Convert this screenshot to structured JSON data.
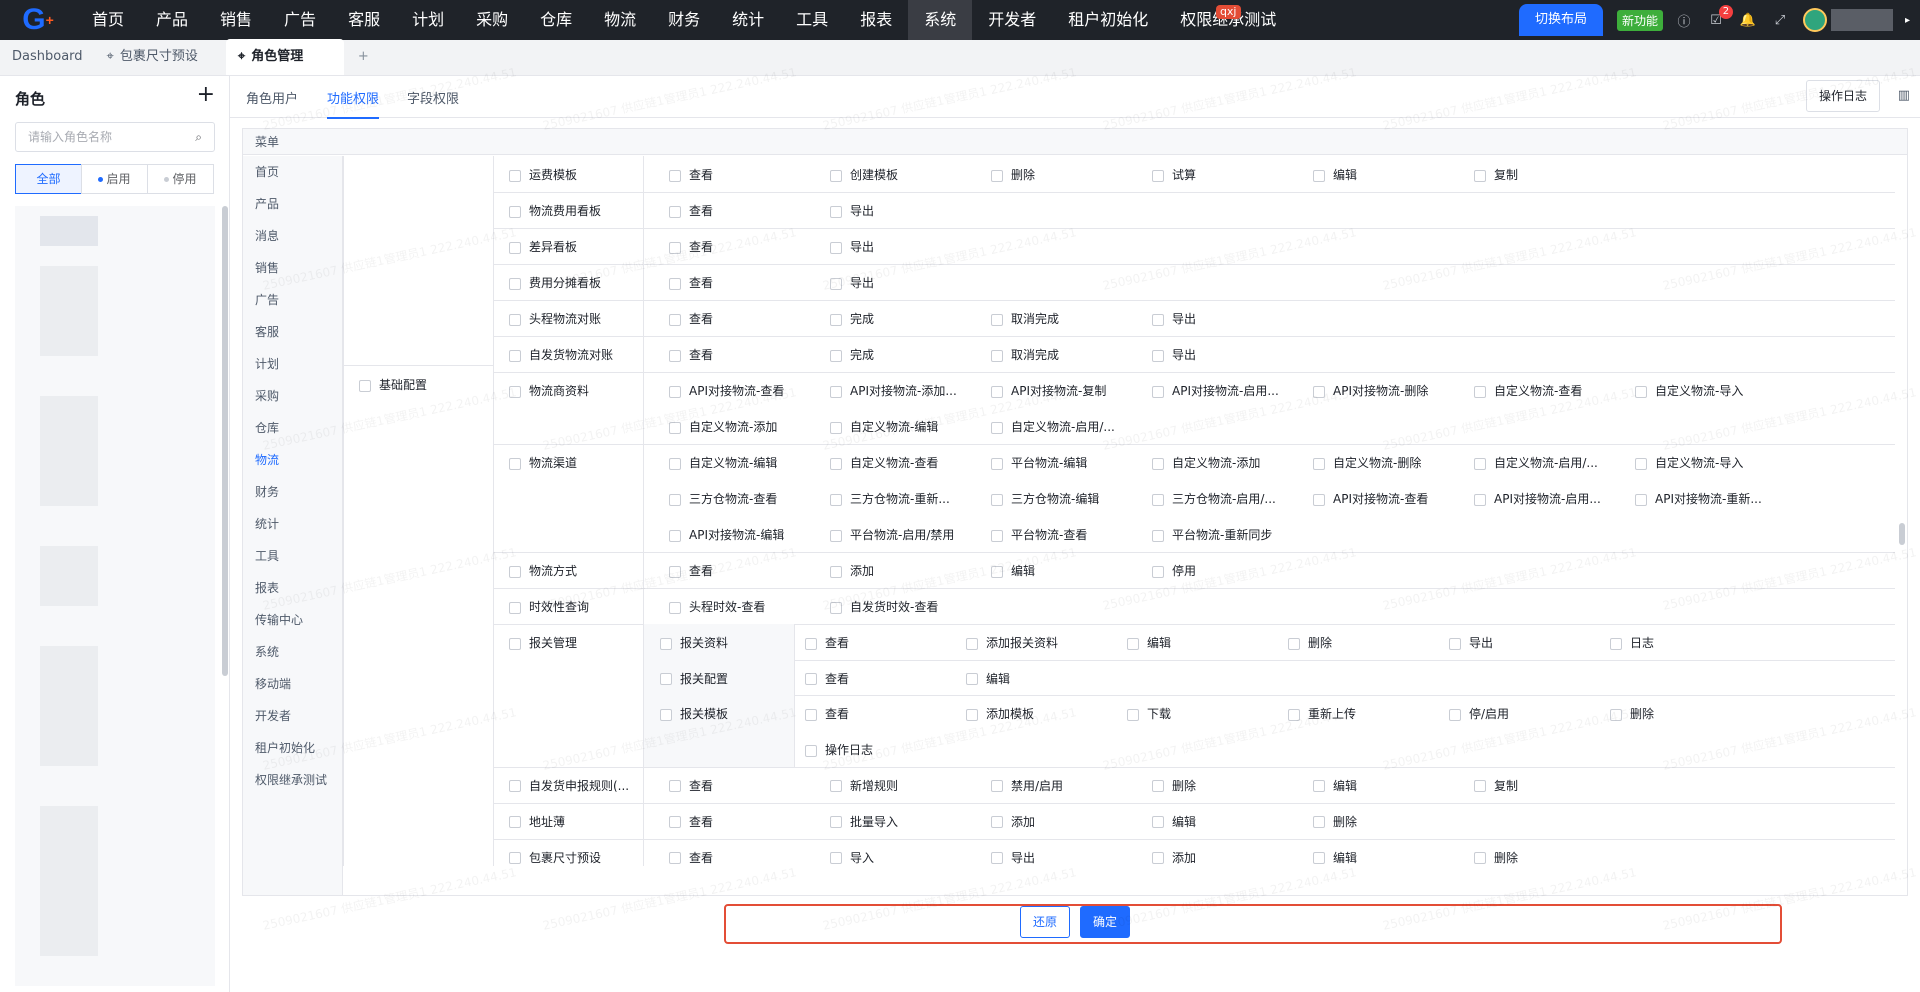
{
  "topnav": {
    "items": [
      "首页",
      "产品",
      "销售",
      "广告",
      "客服",
      "计划",
      "采购",
      "仓库",
      "物流",
      "财务",
      "统计",
      "工具",
      "报表",
      "系统",
      "开发者",
      "租户初始化",
      "权限继承测试"
    ],
    "active_index": 13,
    "switch_layout": "切换布局",
    "qxj_tag": "qxj",
    "new_feature": "新功能",
    "notif_count": "2"
  },
  "tabs": {
    "dashboard": "Dashboard",
    "package_preset": "包裹尺寸预设",
    "role_mgmt": "角色管理",
    "add": "+"
  },
  "sidebar": {
    "title": "角色",
    "add": "+",
    "search_placeholder": "请输入角色名称",
    "filters": [
      "全部",
      "启用",
      "停用"
    ]
  },
  "subtabs": [
    "角色用户",
    "功能权限",
    "字段权限"
  ],
  "oplog": "操作日志",
  "panel": {
    "header": "菜单",
    "menu": [
      "首页",
      "产品",
      "消息",
      "销售",
      "广告",
      "客服",
      "计划",
      "采购",
      "仓库",
      "物流",
      "财务",
      "统计",
      "工具",
      "报表",
      "传输中心",
      "系统",
      "移动端",
      "开发者",
      "租户初始化",
      "权限继承测试"
    ],
    "menu_active": "物流",
    "group_label": "基础配置",
    "rows": [
      {
        "name": "运费模板",
        "perms": [
          "查看",
          "创建模板",
          "删除",
          "试算",
          "编辑",
          "复制"
        ]
      },
      {
        "name": "物流费用看板",
        "perms": [
          "查看",
          "导出"
        ]
      },
      {
        "name": "差异看板",
        "perms": [
          "查看",
          "导出"
        ]
      },
      {
        "name": "费用分摊看板",
        "perms": [
          "查看",
          "导出"
        ]
      },
      {
        "name": "头程物流对账",
        "perms": [
          "查看",
          "完成",
          "取消完成",
          "导出"
        ]
      },
      {
        "name": "自发货物流对账",
        "perms": [
          "查看",
          "完成",
          "取消完成",
          "导出"
        ]
      },
      {
        "name": "物流商资料",
        "perms": [
          "API对接物流-查看",
          "API对接物流-添加...",
          "API对接物流-复制",
          "API对接物流-启用...",
          "API对接物流-删除",
          "自定义物流-查看",
          "自定义物流-导入",
          "自定义物流-添加",
          "自定义物流-编辑",
          "自定义物流-启用/..."
        ]
      },
      {
        "name": "物流渠道",
        "perms": [
          "自定义物流-编辑",
          "自定义物流-查看",
          "平台物流-编辑",
          "自定义物流-添加",
          "自定义物流-删除",
          "自定义物流-启用/...",
          "自定义物流-导入",
          "三方仓物流-查看",
          "三方仓物流-重新...",
          "三方仓物流-编辑",
          "三方仓物流-启用/...",
          "API对接物流-查看",
          "API对接物流-启用...",
          "API对接物流-重新...",
          "API对接物流-编辑",
          "平台物流-启用/禁用",
          "平台物流-查看",
          "平台物流-重新同步"
        ]
      },
      {
        "name": "物流方式",
        "perms": [
          "查看",
          "添加",
          "编辑",
          "停用"
        ]
      },
      {
        "name": "时效性查询",
        "perms": [
          "头程时效-查看",
          "自发货时效-查看"
        ]
      },
      {
        "name": "报关管理",
        "subs": [
          {
            "name": "报关资料",
            "perms": [
              "查看",
              "添加报关资料",
              "编辑",
              "删除",
              "导出",
              "日志"
            ]
          },
          {
            "name": "报关配置",
            "perms": [
              "查看",
              "编辑"
            ]
          },
          {
            "name": "报关模板",
            "perms": [
              "查看",
              "添加模板",
              "下载",
              "重新上传",
              "停/启用",
              "删除",
              "操作日志"
            ]
          }
        ]
      },
      {
        "name": "自发货申报规则(...",
        "perms": [
          "查看",
          "新增规则",
          "禁用/启用",
          "删除",
          "编辑",
          "复制"
        ]
      },
      {
        "name": "地址薄",
        "perms": [
          "查看",
          "批量导入",
          "添加",
          "编辑",
          "删除"
        ]
      },
      {
        "name": "包裹尺寸预设",
        "perms": [
          "查看",
          "导入",
          "导出",
          "添加",
          "编辑",
          "删除"
        ]
      }
    ]
  },
  "buttons": {
    "reset": "还原",
    "confirm": "确定"
  },
  "watermark": "2509021607 供应链1管理员1 222.240.44.51",
  "colors": {
    "accent": "#1f6bff",
    "highlight": "#e34d36",
    "topbar": "#1f2329"
  }
}
